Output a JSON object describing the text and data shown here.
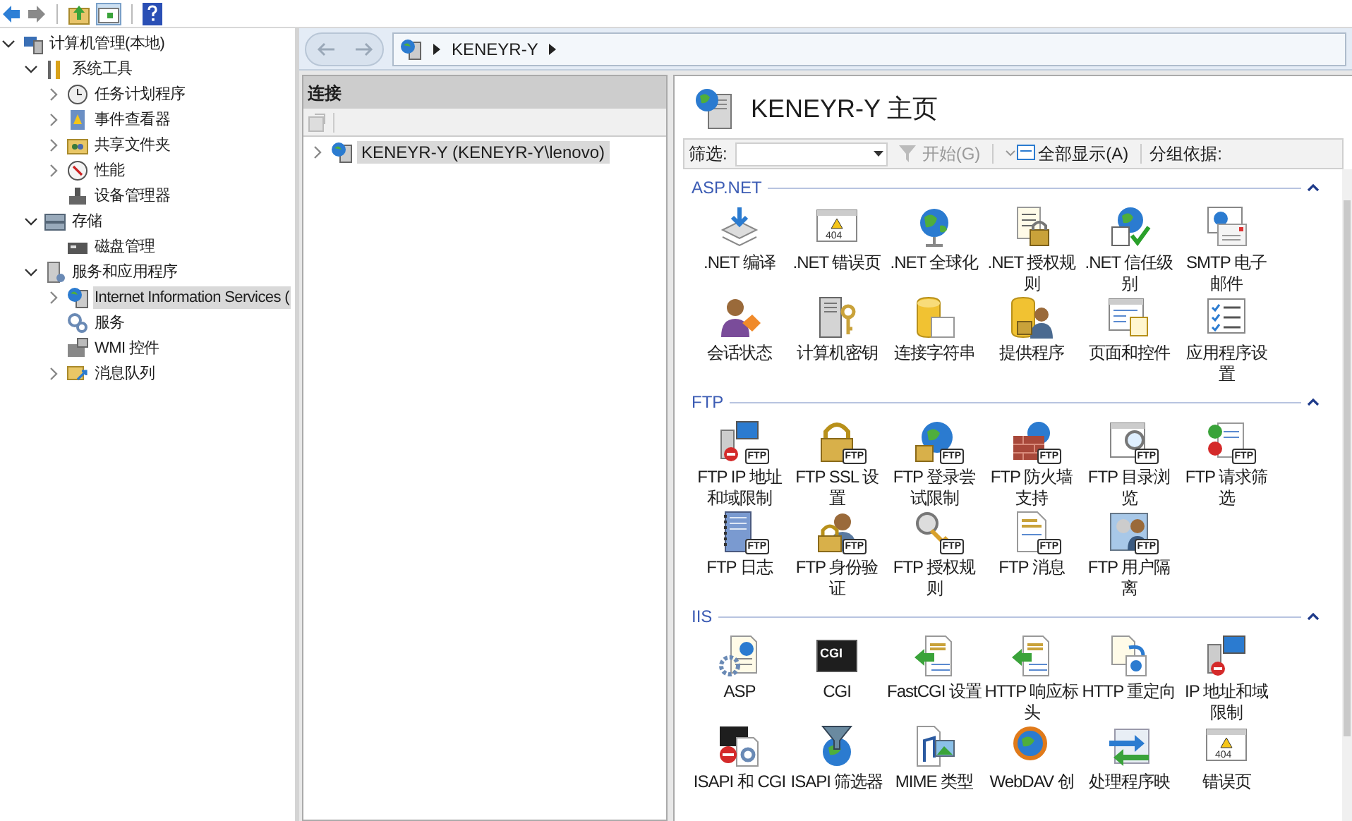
{
  "tree": [
    {
      "label": "计算机管理(本地)",
      "expanded": true,
      "selected": false,
      "children": [
        {
          "label": "系统工具",
          "expanded": true,
          "selected": false,
          "children": [
            {
              "label": "任务计划程序",
              "expanded": false,
              "selected": false
            },
            {
              "label": "事件查看器",
              "expanded": false,
              "selected": false
            },
            {
              "label": "共享文件夹",
              "expanded": false,
              "selected": false
            },
            {
              "label": "性能",
              "expanded": false,
              "selected": false
            },
            {
              "label": "设备管理器",
              "selected": false
            }
          ]
        },
        {
          "label": "存储",
          "expanded": true,
          "selected": false,
          "children": [
            {
              "label": "磁盘管理",
              "selected": false
            }
          ]
        },
        {
          "label": "服务和应用程序",
          "expanded": true,
          "selected": false,
          "children": [
            {
              "label": "Internet Information Services (",
              "expanded": false,
              "selected": true
            },
            {
              "label": "服务",
              "selected": false
            },
            {
              "label": "WMI 控件",
              "selected": false
            },
            {
              "label": "消息队列",
              "expanded": false,
              "selected": false
            }
          ]
        }
      ]
    }
  ],
  "address": {
    "crumbs": [
      "KENEYR-Y"
    ]
  },
  "connections": {
    "title": "连接",
    "items": [
      {
        "label": "KENEYR-Y (KENEYR-Y\\lenovo)",
        "expanded": false,
        "selected": true
      }
    ]
  },
  "home": {
    "title": "KENEYR-Y 主页",
    "filter_label": "筛选:",
    "go": {
      "label": "开始(G)",
      "disabled": true
    },
    "show_all": {
      "label": "全部显示(A)",
      "disabled": false
    },
    "group_by": "分组依据:"
  },
  "groups": [
    {
      "title": "ASP.NET",
      "expanded": true,
      "items": [
        {
          "label": ".NET 编译"
        },
        {
          "label": ".NET 错误页",
          "badge": "404"
        },
        {
          "label": ".NET 全球化"
        },
        {
          "label": ".NET 授权规则"
        },
        {
          "label": ".NET 信任级别"
        },
        {
          "label": "SMTP 电子邮件"
        },
        {
          "label": "会话状态"
        },
        {
          "label": "计算机密钥"
        },
        {
          "label": "连接字符串"
        },
        {
          "label": "提供程序"
        },
        {
          "label": "页面和控件"
        },
        {
          "label": "应用程序设置"
        }
      ]
    },
    {
      "title": "FTP",
      "expanded": true,
      "items": [
        {
          "label": "FTP IP 地址和域限制",
          "badge": "FTP"
        },
        {
          "label": "FTP SSL 设置",
          "badge": "FTP"
        },
        {
          "label": "FTP 登录尝试限制",
          "badge": "FTP"
        },
        {
          "label": "FTP 防火墙支持",
          "badge": "FTP"
        },
        {
          "label": "FTP 目录浏览",
          "badge": "FTP"
        },
        {
          "label": "FTP 请求筛选",
          "badge": "FTP"
        },
        {
          "label": "FTP 日志",
          "badge": "FTP"
        },
        {
          "label": "FTP 身份验证",
          "badge": "FTP"
        },
        {
          "label": "FTP 授权规则",
          "badge": "FTP"
        },
        {
          "label": "FTP 消息",
          "badge": "FTP"
        },
        {
          "label": "FTP 用户隔离",
          "badge": "FTP"
        }
      ]
    },
    {
      "title": "IIS",
      "expanded": true,
      "items": [
        {
          "label": "ASP"
        },
        {
          "label": "CGI",
          "badge": "CGI"
        },
        {
          "label": "FastCGI 设置"
        },
        {
          "label": "HTTP 响应标头"
        },
        {
          "label": "HTTP 重定向"
        },
        {
          "label": "IP 地址和域限制"
        },
        {
          "label": "ISAPI 和 CGI"
        },
        {
          "label": "ISAPI 筛选器"
        },
        {
          "label": "MIME 类型"
        },
        {
          "label": "WebDAV 创"
        },
        {
          "label": "处理程序映"
        },
        {
          "label": "错误页",
          "badge": "404"
        }
      ]
    }
  ]
}
